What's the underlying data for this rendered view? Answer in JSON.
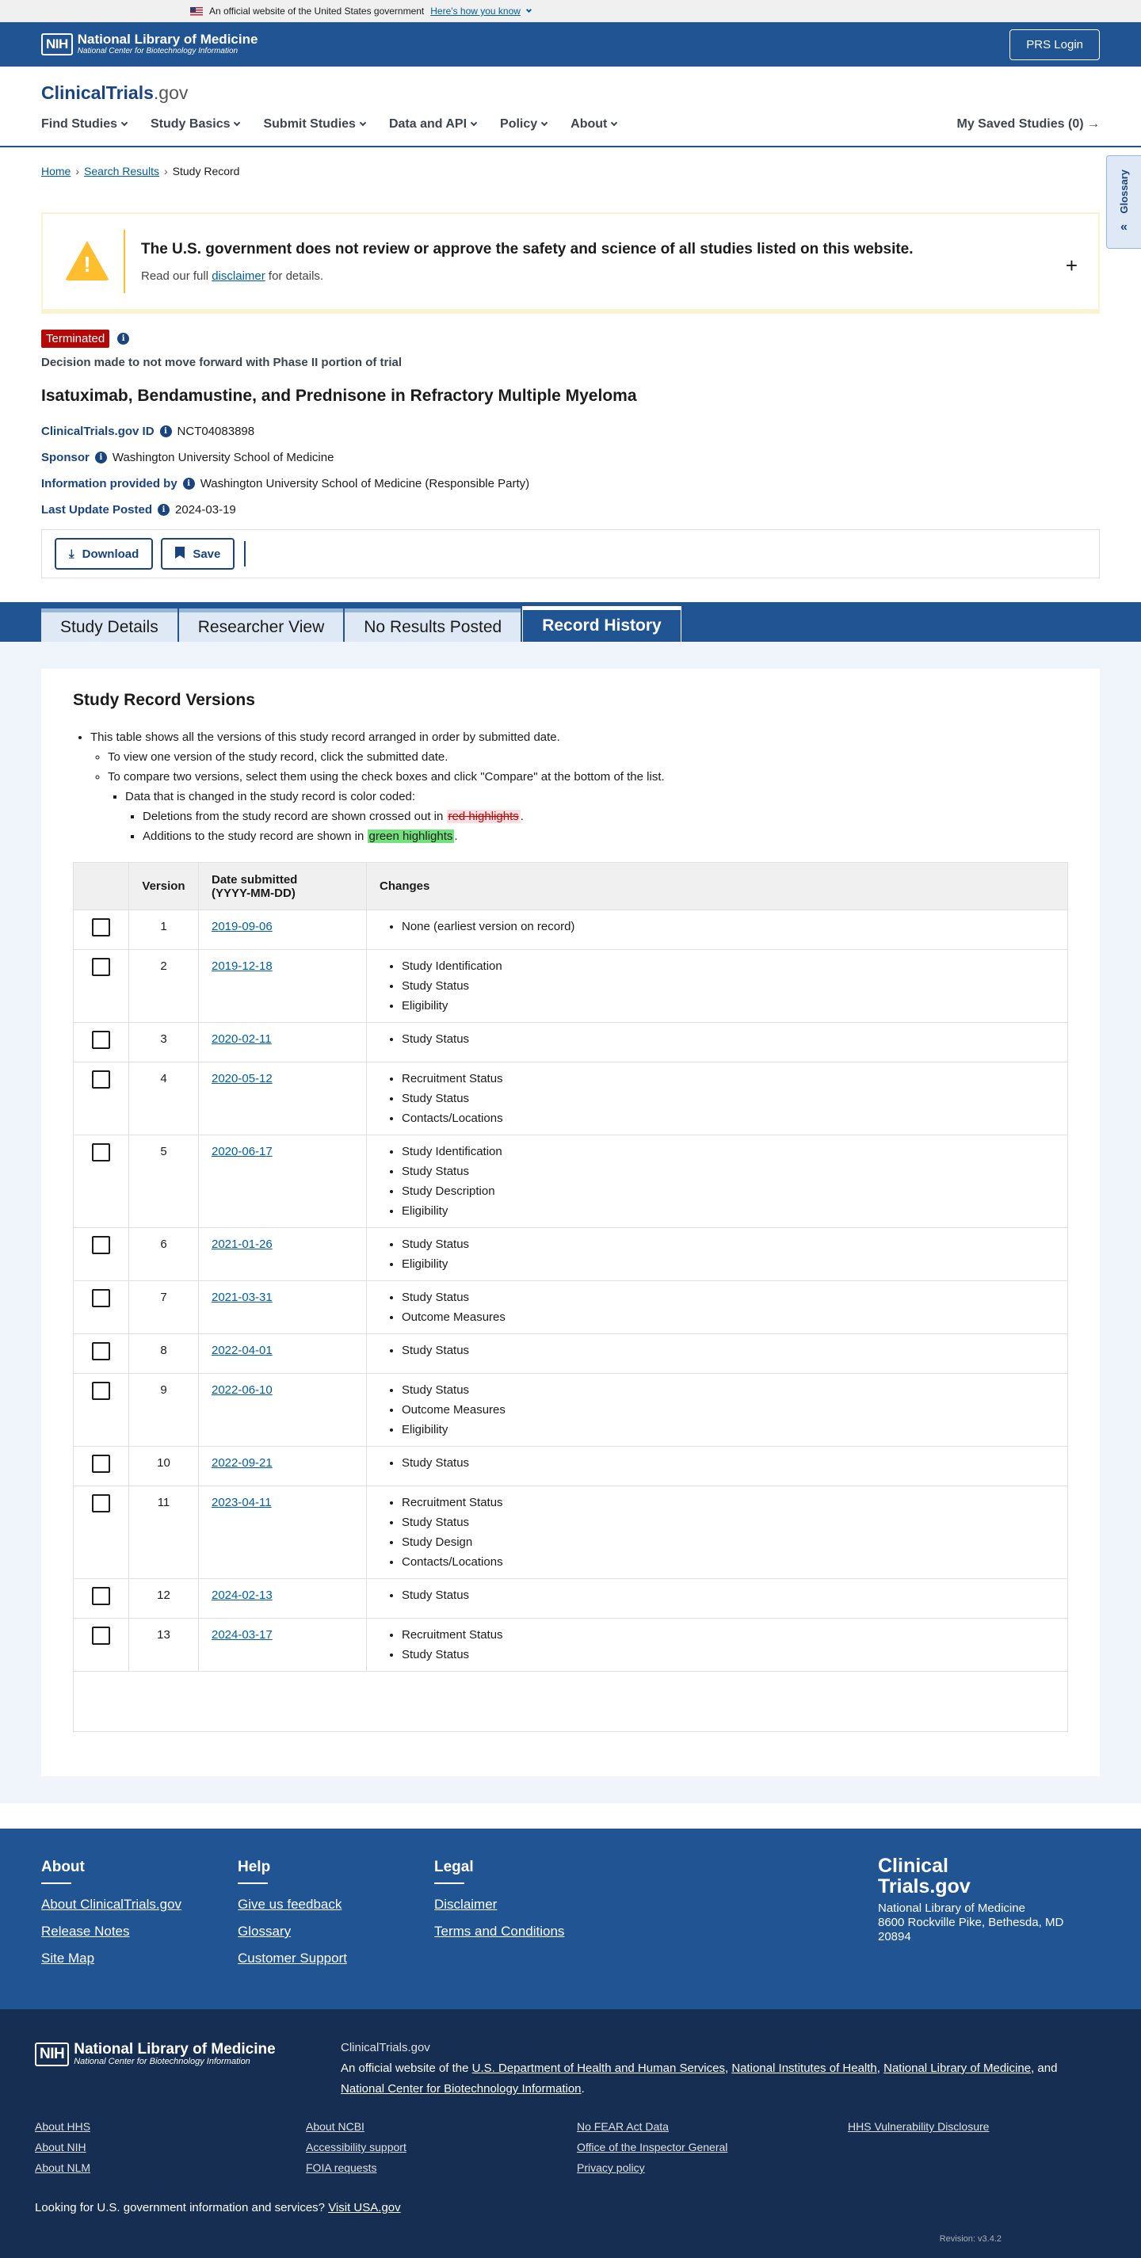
{
  "gov_banner": {
    "text": "An official website of the United States government",
    "link": "Here's how you know"
  },
  "nih_header": {
    "abbr": "NIH",
    "name": "National Library of Medicine",
    "sub": "National Center for Biotechnology Information",
    "prs_login": "PRS Login"
  },
  "site": {
    "logo_main": "ClinicalTrials",
    "logo_suffix": ".gov"
  },
  "nav": {
    "items": [
      "Find Studies",
      "Study Basics",
      "Submit Studies",
      "Data and API",
      "Policy",
      "About"
    ],
    "saved": "My Saved Studies (0)"
  },
  "glossary": "Glossary",
  "breadcrumb": [
    "Home",
    "Search Results",
    "Study Record"
  ],
  "disclaimer": {
    "title": "The U.S. government does not review or approve the safety and science of all studies listed on this website.",
    "pre": "Read our full ",
    "link": "disclaimer",
    "post": " for details."
  },
  "study": {
    "status": "Terminated",
    "status_reason": "Decision made to not move forward with Phase II portion of trial",
    "title": "Isatuximab, Bendamustine, and Prednisone in Refractory Multiple Myeloma",
    "meta": [
      {
        "label": "ClinicalTrials.gov ID",
        "value": "NCT04083898"
      },
      {
        "label": "Sponsor",
        "value": "Washington University School of Medicine"
      },
      {
        "label": "Information provided by",
        "value": "Washington University School of Medicine (Responsible Party)"
      },
      {
        "label": "Last Update Posted",
        "value": "2024-03-19"
      }
    ]
  },
  "actions": {
    "download": "Download",
    "save": "Save"
  },
  "tabs": [
    "Study Details",
    "Researcher View",
    "No Results Posted",
    "Record History"
  ],
  "history": {
    "title": "Study Record Versions",
    "bullet1": "This table shows all the versions of this study record arranged in order by submitted date.",
    "bullet1a": "To view one version of the study record, click the submitted date.",
    "bullet1b": "To compare two versions, select them using the check boxes and click \"Compare\" at the bottom of the list.",
    "bullet1b1": "Data that is changed in the study record is color coded:",
    "del_pre": "Deletions from the study record are shown crossed out in ",
    "del_hl": "red highlights",
    "add_pre": "Additions to the study record are shown in ",
    "add_hl": "green highlights",
    "period": ".",
    "columns": {
      "version": "Version",
      "date1": "Date submitted",
      "date2": "(YYYY-MM-DD)",
      "changes": "Changes"
    },
    "rows": [
      {
        "version": "1",
        "date": "2019-09-06",
        "changes": [
          "None (earliest version on record)"
        ]
      },
      {
        "version": "2",
        "date": "2019-12-18",
        "changes": [
          "Study Identification",
          "Study Status",
          "Eligibility"
        ]
      },
      {
        "version": "3",
        "date": "2020-02-11",
        "changes": [
          "Study Status"
        ]
      },
      {
        "version": "4",
        "date": "2020-05-12",
        "changes": [
          "Recruitment Status",
          "Study Status",
          "Contacts/Locations"
        ]
      },
      {
        "version": "5",
        "date": "2020-06-17",
        "changes": [
          "Study Identification",
          "Study Status",
          "Study Description",
          "Eligibility"
        ]
      },
      {
        "version": "6",
        "date": "2021-01-26",
        "changes": [
          "Study Status",
          "Eligibility"
        ]
      },
      {
        "version": "7",
        "date": "2021-03-31",
        "changes": [
          "Study Status",
          "Outcome Measures"
        ]
      },
      {
        "version": "8",
        "date": "2022-04-01",
        "changes": [
          "Study Status"
        ]
      },
      {
        "version": "9",
        "date": "2022-06-10",
        "changes": [
          "Study Status",
          "Outcome Measures",
          "Eligibility"
        ]
      },
      {
        "version": "10",
        "date": "2022-09-21",
        "changes": [
          "Study Status"
        ]
      },
      {
        "version": "11",
        "date": "2023-04-11",
        "changes": [
          "Recruitment Status",
          "Study Status",
          "Study Design",
          "Contacts/Locations"
        ]
      },
      {
        "version": "12",
        "date": "2024-02-13",
        "changes": [
          "Study Status"
        ]
      },
      {
        "version": "13",
        "date": "2024-03-17",
        "changes": [
          "Recruitment Status",
          "Study Status"
        ]
      }
    ]
  },
  "footer": {
    "about": {
      "title": "About",
      "links": [
        "About ClinicalTrials.gov",
        "Release Notes",
        "Site Map"
      ]
    },
    "help": {
      "title": "Help",
      "links": [
        "Give us feedback",
        "Glossary",
        "Customer Support"
      ]
    },
    "legal": {
      "title": "Legal",
      "links": [
        "Disclaimer",
        "Terms and Conditions"
      ]
    },
    "logo1": "Clinical",
    "logo2": "Trials.gov",
    "addr1": "National Library of Medicine",
    "addr2": "8600 Rockville Pike, Bethesda, MD",
    "addr3": "20894",
    "ct_label": "ClinicalTrials.gov",
    "official_pre": "An official website of the ",
    "org1": "U.S. Department of Health and Human Services",
    "org2": "National Institutes of Health",
    "org3": "National Library of Medicine",
    "org4": "National Center for Biotechnology Information",
    "comma": ", ",
    "and": ", and ",
    "period": ".",
    "links": [
      "About HHS",
      "About NCBI",
      "No FEAR Act Data",
      "HHS Vulnerability Disclosure",
      "About NIH",
      "Accessibility support",
      "Office of the Inspector General",
      "About NLM",
      "FOIA requests",
      "Privacy policy"
    ],
    "usa_pre": "Looking for U.S. government information and services?",
    "usa_link": "Visit USA.gov",
    "revision": "Revision: v3.4.2"
  }
}
